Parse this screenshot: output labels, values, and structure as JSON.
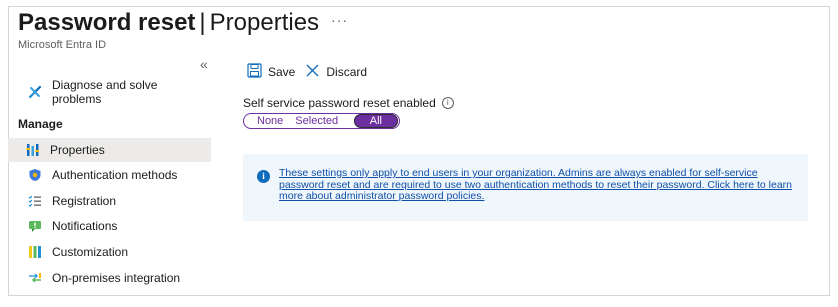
{
  "header": {
    "title_strong": "Password reset",
    "title_separator": "|",
    "title_light": "Properties",
    "more": "···",
    "subtitle": "Microsoft Entra ID"
  },
  "sidebar": {
    "collapse": "«",
    "top_items": [
      {
        "label": "Diagnose and solve problems",
        "icon": "wrench-icon"
      }
    ],
    "section_label": "Manage",
    "items": [
      {
        "label": "Properties",
        "icon": "properties-icon",
        "active": true
      },
      {
        "label": "Authentication methods",
        "icon": "shield-icon"
      },
      {
        "label": "Registration",
        "icon": "list-icon"
      },
      {
        "label": "Notifications",
        "icon": "notification-icon"
      },
      {
        "label": "Customization",
        "icon": "customization-icon"
      },
      {
        "label": "On-premises integration",
        "icon": "sync-icon"
      }
    ]
  },
  "toolbar": {
    "save_label": "Save",
    "discard_label": "Discard"
  },
  "sspr": {
    "label": "Self service password reset enabled",
    "info": "i",
    "options": [
      "None",
      "Selected",
      "All"
    ],
    "selected": "All"
  },
  "banner": {
    "icon": "i",
    "text": "These settings only apply to end users in your organization. Admins are always enabled for self-service password reset and are required to use two authentication methods to reset their password. Click here to learn more about administrator password policies."
  },
  "colors": {
    "accent": "#6b2fa0",
    "link": "#0f4fa8",
    "banner_bg": "#eff6fc",
    "active_bg": "#edebe9"
  }
}
